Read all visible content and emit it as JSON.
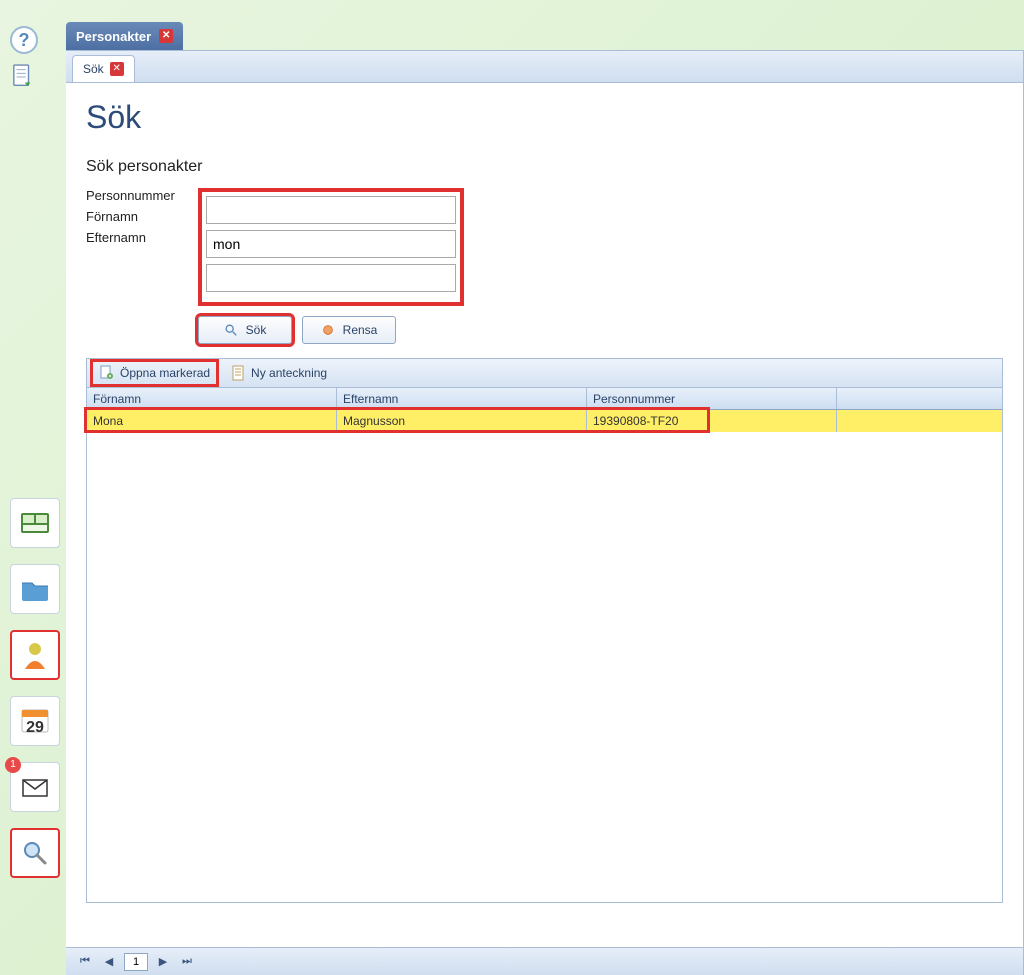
{
  "window": {
    "tab_title": "Personakter"
  },
  "inner_tab": {
    "title": "Sök"
  },
  "page": {
    "title": "Sök",
    "section_title": "Sök personakter"
  },
  "form": {
    "personnummer_label": "Personnummer",
    "personnummer_value": "",
    "fornamn_label": "Förnamn",
    "fornamn_value": "mon",
    "efternamn_label": "Efternamn",
    "efternamn_value": ""
  },
  "buttons": {
    "search": "Sök",
    "clear": "Rensa"
  },
  "toolbar": {
    "open_selected": "Öppna markerad",
    "new_note": "Ny anteckning"
  },
  "grid": {
    "headers": {
      "fornamn": "Förnamn",
      "efternamn": "Efternamn",
      "personnummer": "Personnummer"
    },
    "rows": [
      {
        "fornamn": "Mona",
        "efternamn": "Magnusson",
        "personnummer": "19390808-TF20"
      }
    ]
  },
  "pager": {
    "page": "1"
  },
  "sidebar": {
    "calendar_day": "29",
    "mail_badge": "1"
  }
}
